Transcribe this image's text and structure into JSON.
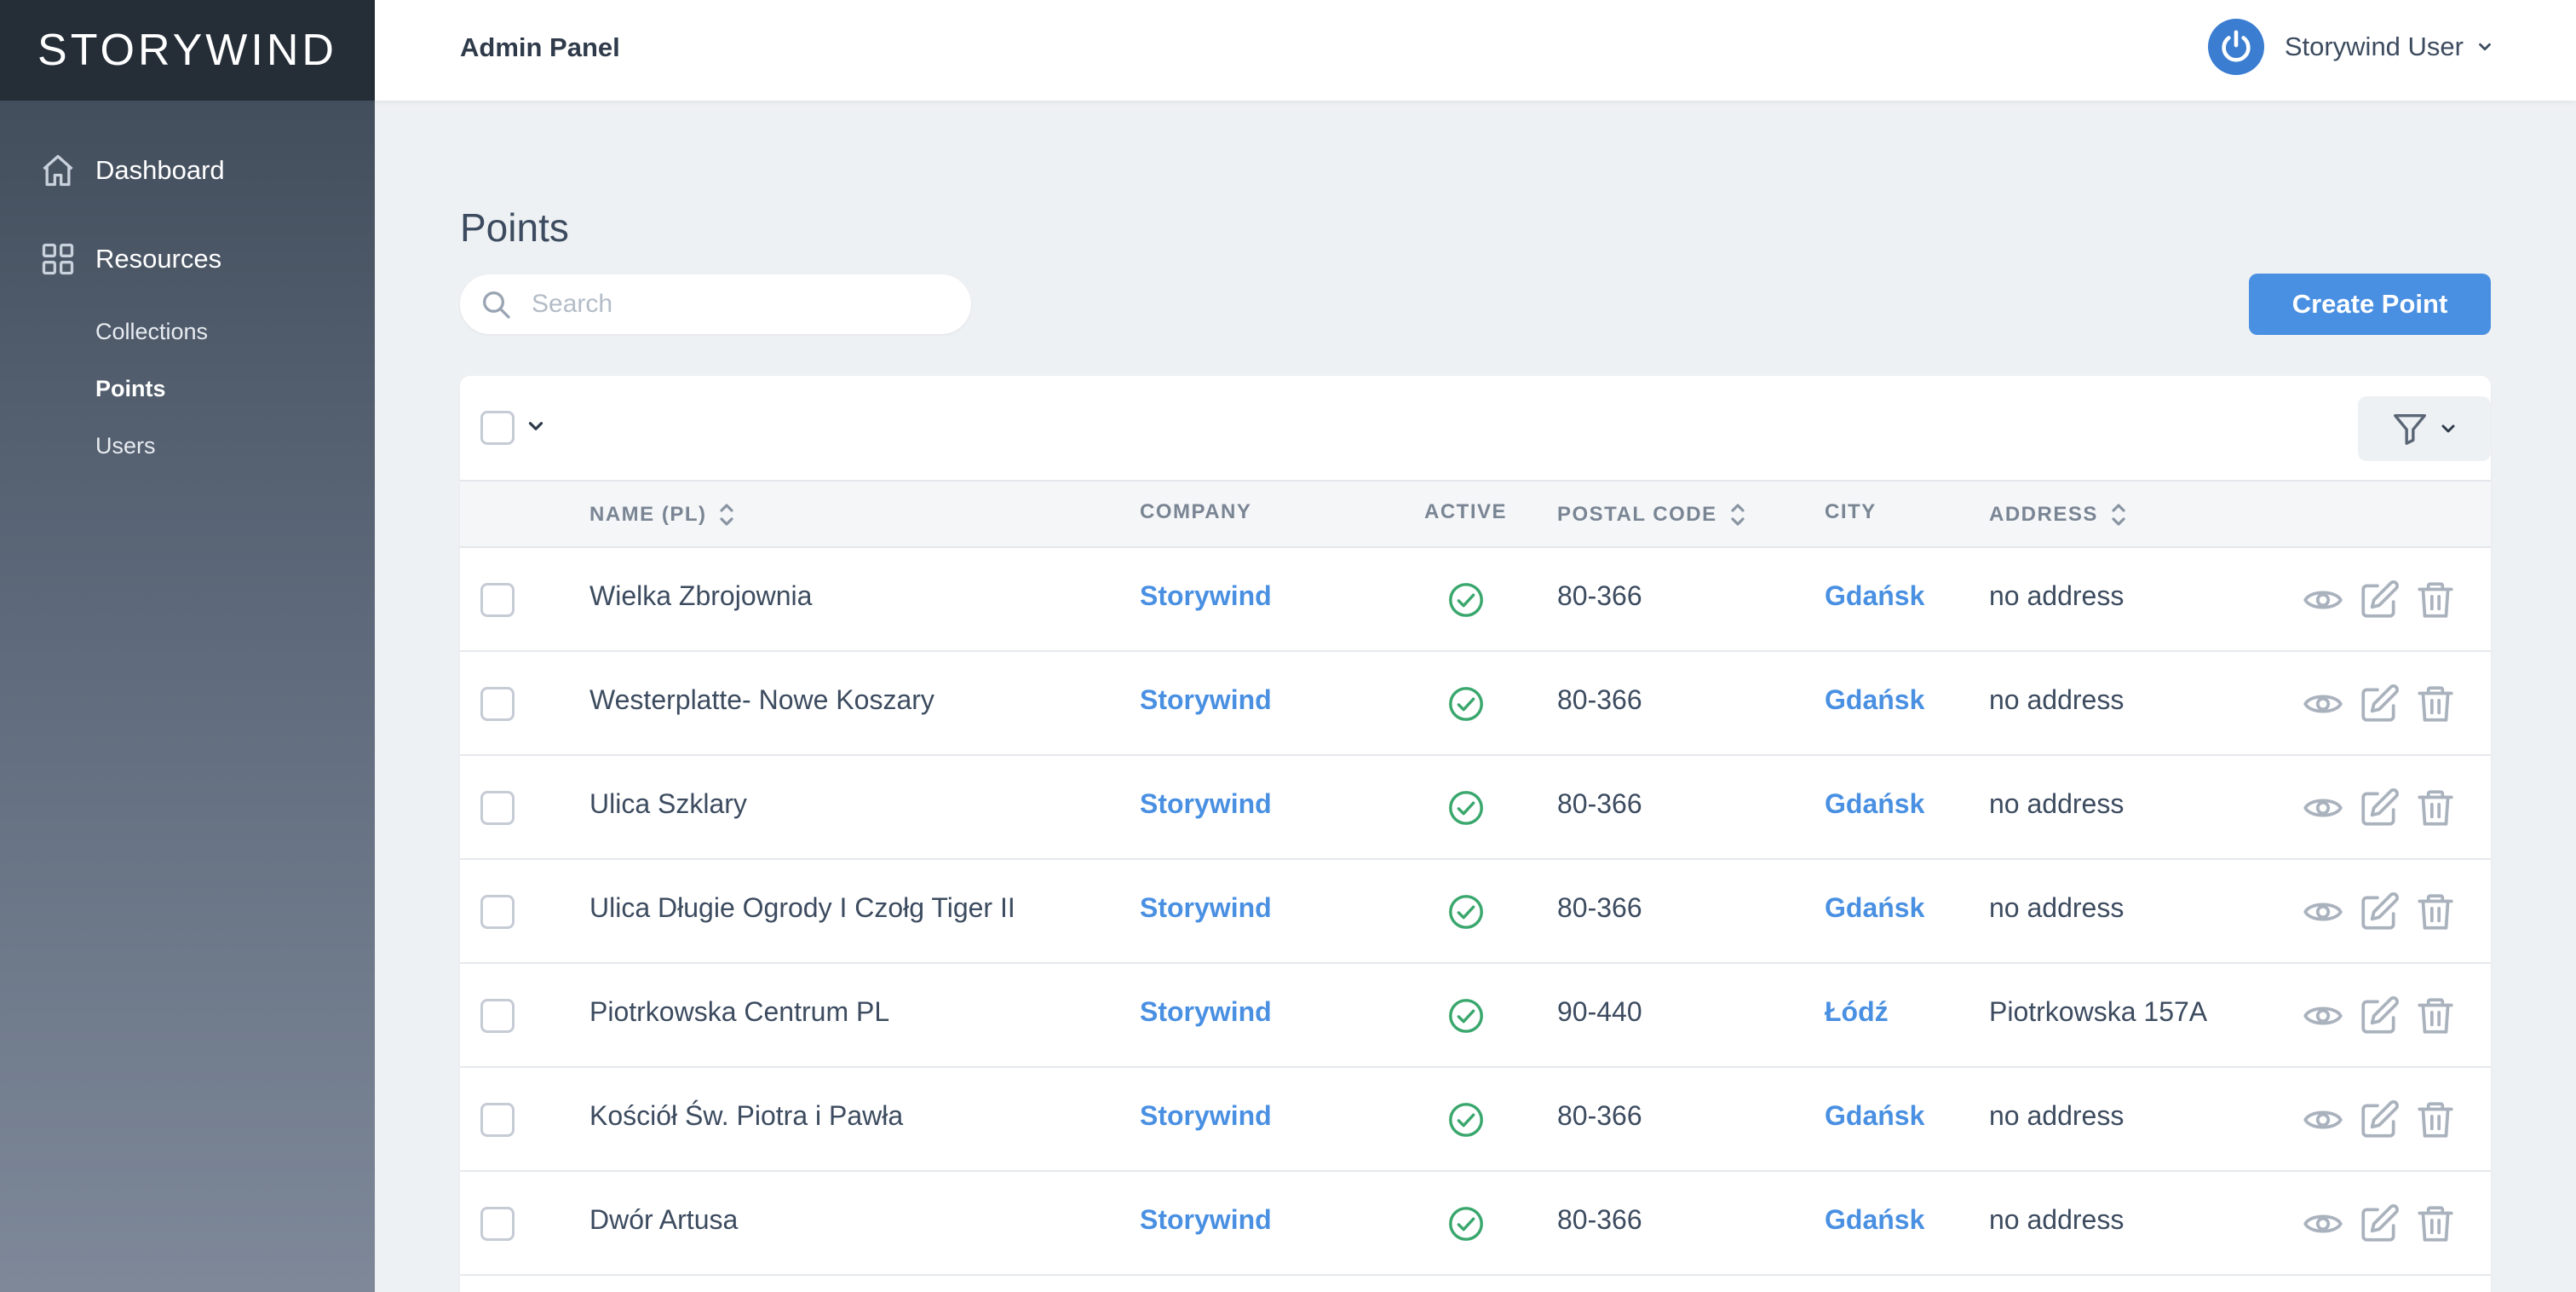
{
  "brand": "STORYWIND",
  "sidebar": {
    "items": [
      {
        "label": "Dashboard",
        "icon": "home-icon"
      },
      {
        "label": "Resources",
        "icon": "grid-icon"
      }
    ],
    "subitems": [
      {
        "label": "Collections",
        "active": false
      },
      {
        "label": "Points",
        "active": true
      },
      {
        "label": "Users",
        "active": false
      }
    ]
  },
  "header": {
    "title": "Admin Panel",
    "user": "Storywind User"
  },
  "main": {
    "page_title": "Points",
    "search_placeholder": "Search",
    "search_value": "",
    "create_label": "Create Point"
  },
  "table": {
    "columns": [
      "NAME (PL)",
      "COMPANY",
      "ACTIVE",
      "POSTAL CODE",
      "CITY",
      "ADDRESS"
    ],
    "rows": [
      {
        "name": "Wielka Zbrojownia",
        "company": "Storywind",
        "active": true,
        "postal": "80-366",
        "city": "Gdańsk",
        "address": "no address"
      },
      {
        "name": "Westerplatte- Nowe Koszary",
        "company": "Storywind",
        "active": true,
        "postal": "80-366",
        "city": "Gdańsk",
        "address": "no address"
      },
      {
        "name": "Ulica Szklary",
        "company": "Storywind",
        "active": true,
        "postal": "80-366",
        "city": "Gdańsk",
        "address": "no address"
      },
      {
        "name": "Ulica Długie Ogrody I Czołg Tiger II",
        "company": "Storywind",
        "active": true,
        "postal": "80-366",
        "city": "Gdańsk",
        "address": "no address"
      },
      {
        "name": "Piotrkowska Centrum PL",
        "company": "Storywind",
        "active": true,
        "postal": "90-440",
        "city": "Łódź",
        "address": "Piotrkowska 157A"
      },
      {
        "name": "Kościół Św. Piotra i Pawła",
        "company": "Storywind",
        "active": true,
        "postal": "80-366",
        "city": "Gdańsk",
        "address": "no address"
      },
      {
        "name": "Dwór Artusa",
        "company": "Storywind",
        "active": true,
        "postal": "80-366",
        "city": "Gdańsk",
        "address": "no address"
      }
    ]
  },
  "colors": {
    "accent": "#4a90e2",
    "active_green": "#3aa76d",
    "sidebar_dark": "#252d37"
  }
}
